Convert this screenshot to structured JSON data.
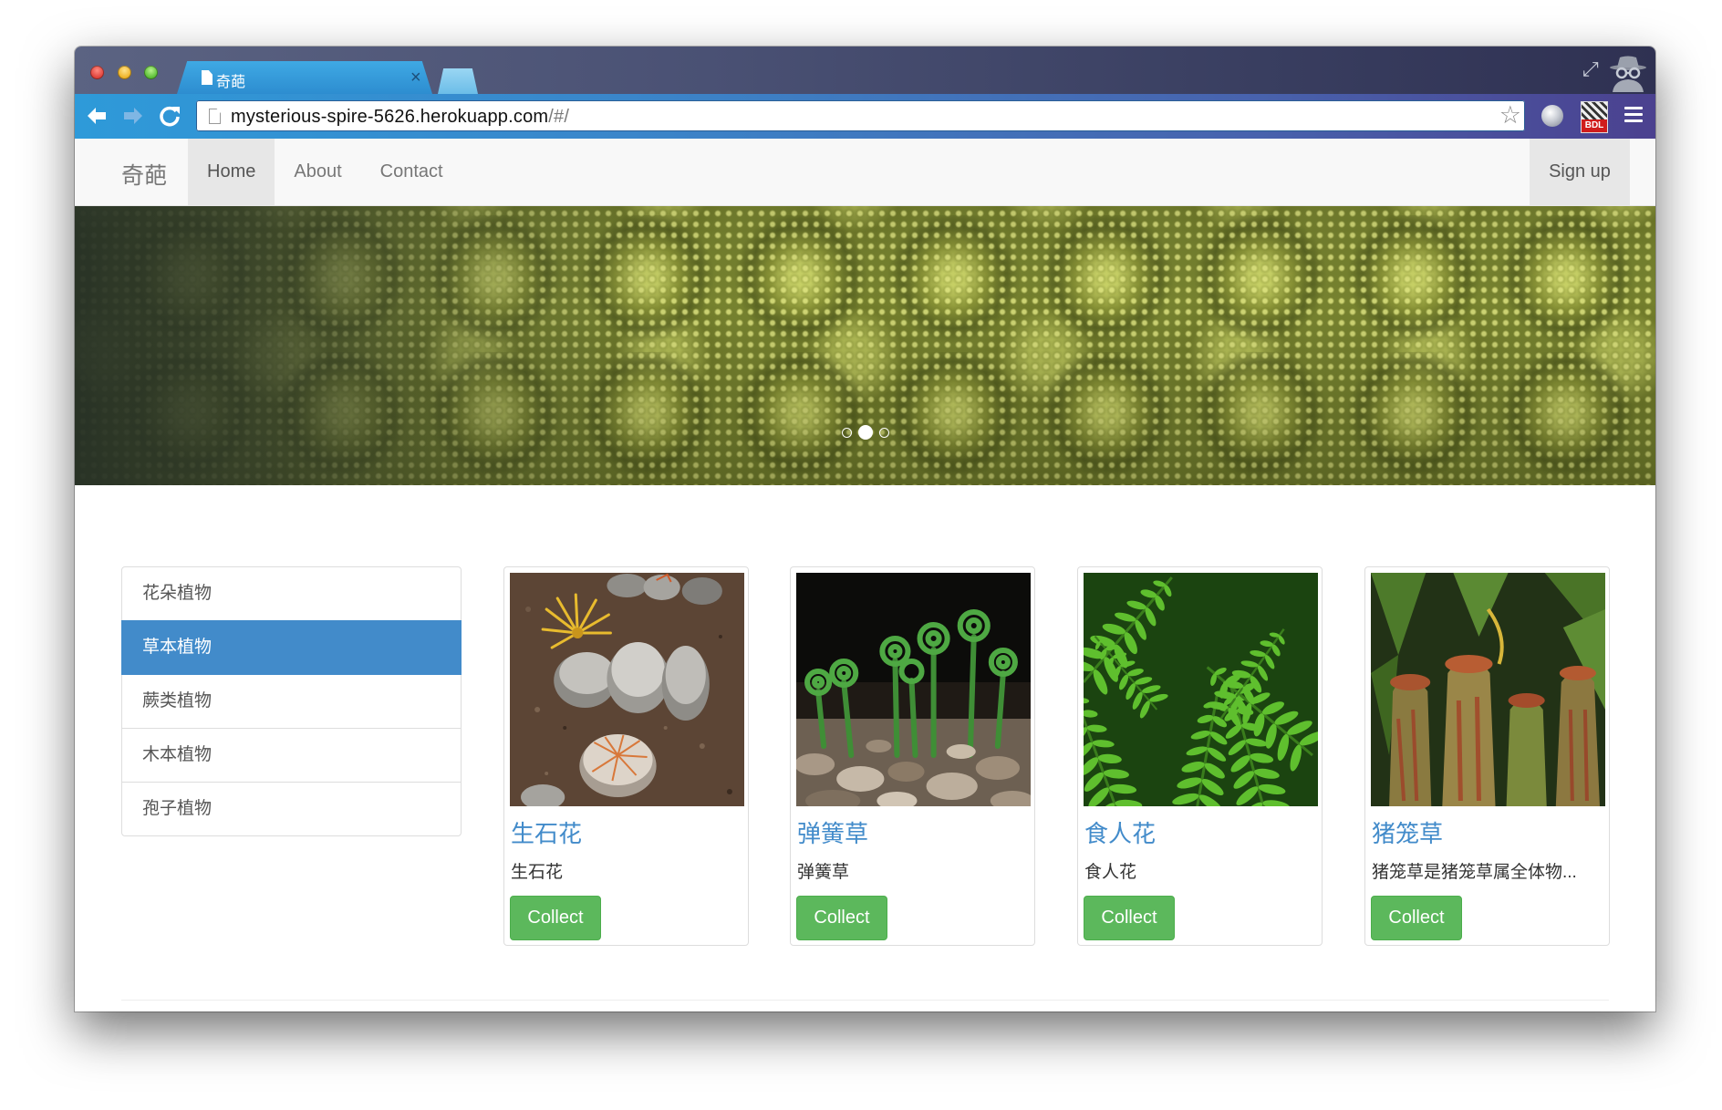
{
  "browser": {
    "tab_title": "奇葩",
    "tab_close": "×",
    "url_host": "mysterious-spire-5626.herokuapp.com",
    "url_path": "/#/",
    "extension_label": "BDL",
    "icons": [
      "back-arrow-icon",
      "forward-arrow-icon",
      "reload-icon",
      "page-icon",
      "star-icon",
      "globe-icon",
      "bdl-extension-icon",
      "menu-icon",
      "incognito-icon",
      "resize-icon"
    ]
  },
  "navbar": {
    "brand": "奇葩",
    "items": [
      "Home",
      "About",
      "Contact"
    ],
    "active_index": 0,
    "signup": "Sign up"
  },
  "carousel": {
    "indicator_count": 3,
    "active_index": 1
  },
  "sidebar": {
    "items": [
      "花朵植物",
      "草本植物",
      "蕨类植物",
      "木本植物",
      "孢子植物"
    ],
    "active_index": 1
  },
  "cards": [
    {
      "title": "生石花",
      "description": "生石花",
      "button": "Collect"
    },
    {
      "title": "弹簧草",
      "description": "弹簧草",
      "button": "Collect"
    },
    {
      "title": "食人花",
      "description": "食人花",
      "button": "Collect"
    },
    {
      "title": "猪笼草",
      "description": "猪笼草是猪笼草属全体物...",
      "button": "Collect"
    }
  ],
  "colors": {
    "primary": "#428bca",
    "success": "#5cb85c",
    "navbar_bg": "#f8f8f8",
    "nav_active_bg": "#e7e7e7"
  }
}
